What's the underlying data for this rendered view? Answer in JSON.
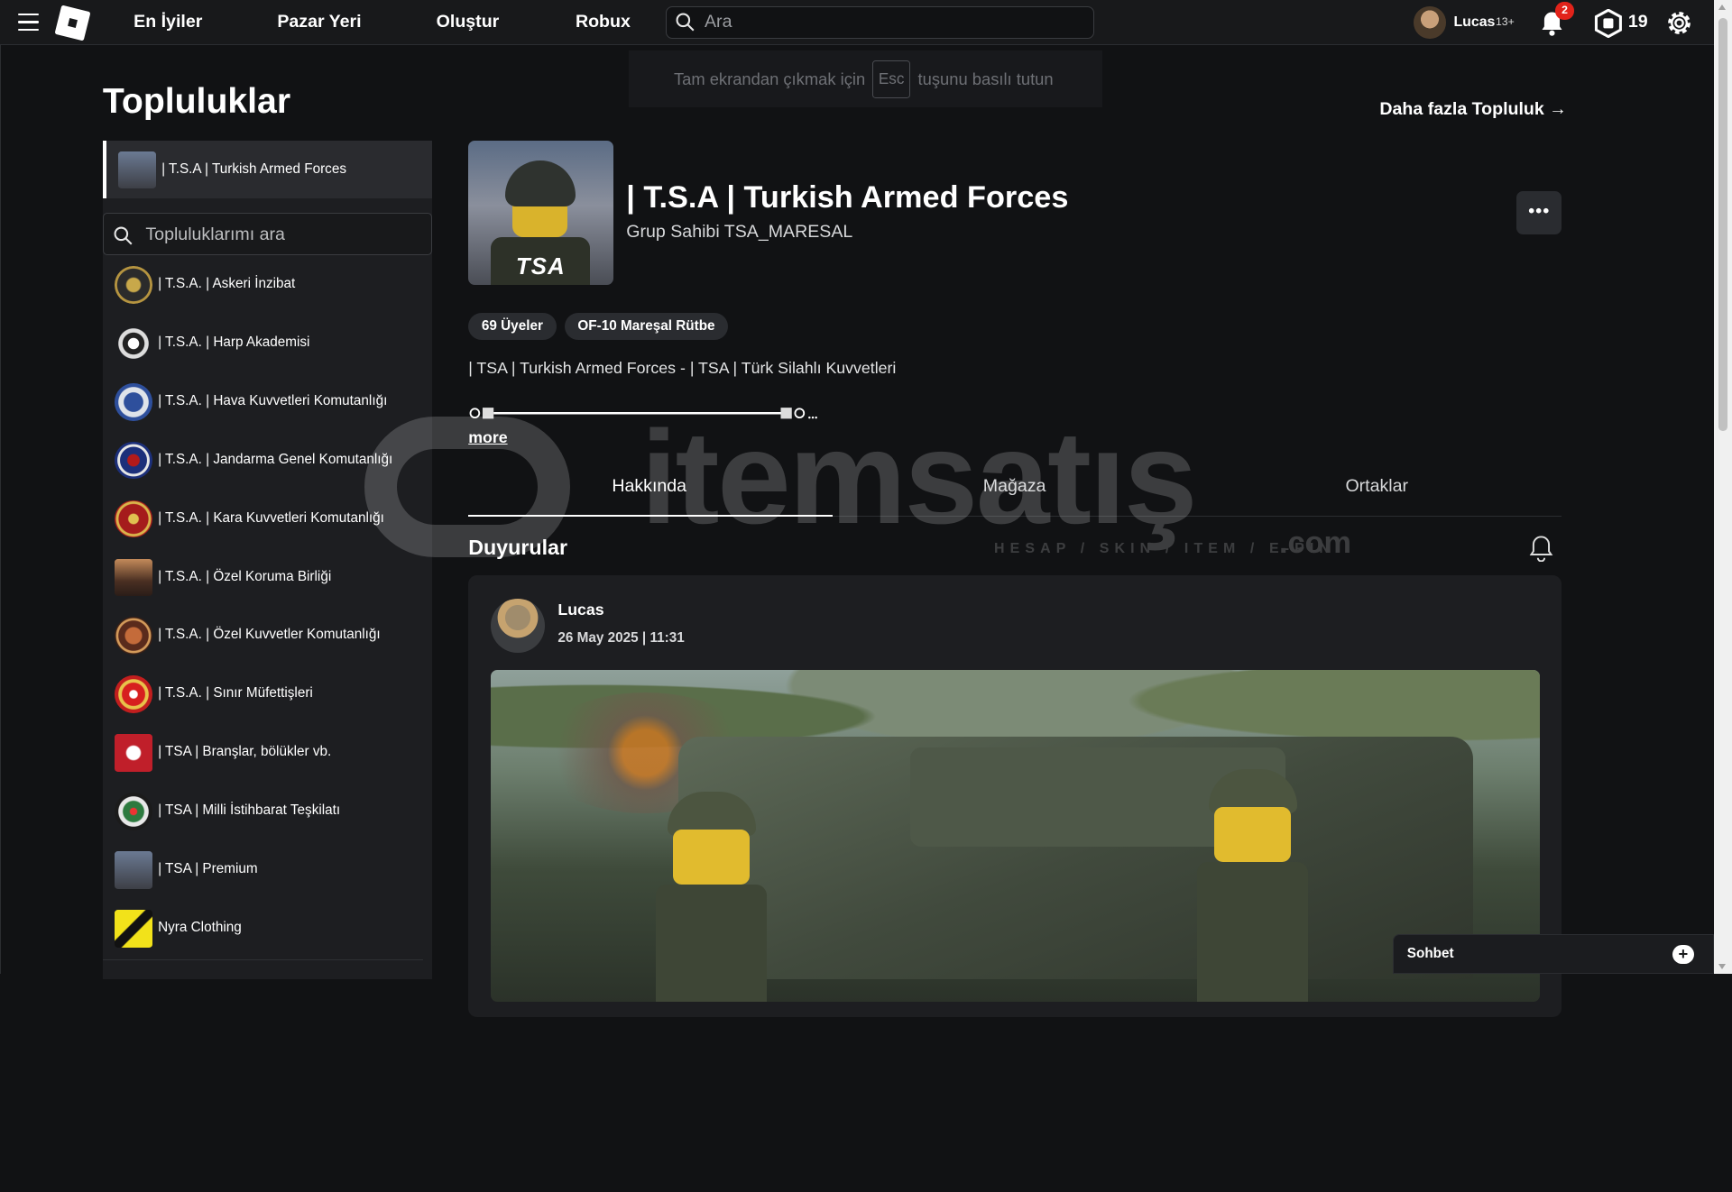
{
  "nav": {
    "items": [
      "En İyiler",
      "Pazar Yeri",
      "Oluştur",
      "Robux"
    ],
    "search_placeholder": "Ara",
    "username": "Lucas",
    "age_tag": "13+",
    "notification_count": "2",
    "robux_count": "19"
  },
  "fullscreen_toast": {
    "before": "Tam ekrandan çıkmak için",
    "key": "Esc",
    "after": "tuşunu basılı tutun"
  },
  "page": {
    "title": "Topluluklar",
    "more_communities": "Daha fazla Topluluk →"
  },
  "sidebar": {
    "selected": "| T.S.A | Turkish Armed Forces",
    "search_placeholder": "Topluluklarımı ara",
    "items": [
      "| T.S.A. | Askeri İnzibat",
      "| T.S.A. | Harp Akademisi",
      "| T.S.A. | Hava Kuvvetleri Komutanlığı",
      "| T.S.A. | Jandarma Genel Komutanlığı",
      "| T.S.A. | Kara Kuvvetleri Komutanlığı",
      "| T.S.A. | Özel Koruma Birliği",
      "| T.S.A. | Özel Kuvvetler Komutanlığı",
      "| T.S.A. | Sınır Müfettişleri",
      "| TSA | Branşlar, bölükler vb.",
      "| TSA | Milli İstihbarat Teşkilatı",
      "| TSA | Premium",
      "Nyra Clothing"
    ]
  },
  "group": {
    "image_text": "TSA",
    "name": "| T.S.A | Turkish Armed Forces",
    "owner": "Grup Sahibi TSA_MARESAL",
    "members": "69 Üyeler",
    "rank": "OF-10 Mareşal Rütbe",
    "description": "| TSA | Turkish Armed Forces - | TSA | Türk Silahlı Kuvvetleri",
    "more": "more",
    "menu_label": "•••"
  },
  "tabs": [
    "Hakkında",
    "Mağaza",
    "Ortaklar"
  ],
  "announcements": {
    "title": "Duyurular",
    "post": {
      "author": "Lucas",
      "date": "26 May 2025 | 11:31"
    }
  },
  "watermark": {
    "text": "itemsatış",
    "sub": "HESAP / SKIN / ITEM / E-PIN",
    "com": ".com"
  },
  "chat": {
    "label": "Sohbet",
    "plus": "+"
  },
  "colors": {
    "background": "#111214",
    "panel": "#1d1e21",
    "badge_red": "#e2231a"
  }
}
